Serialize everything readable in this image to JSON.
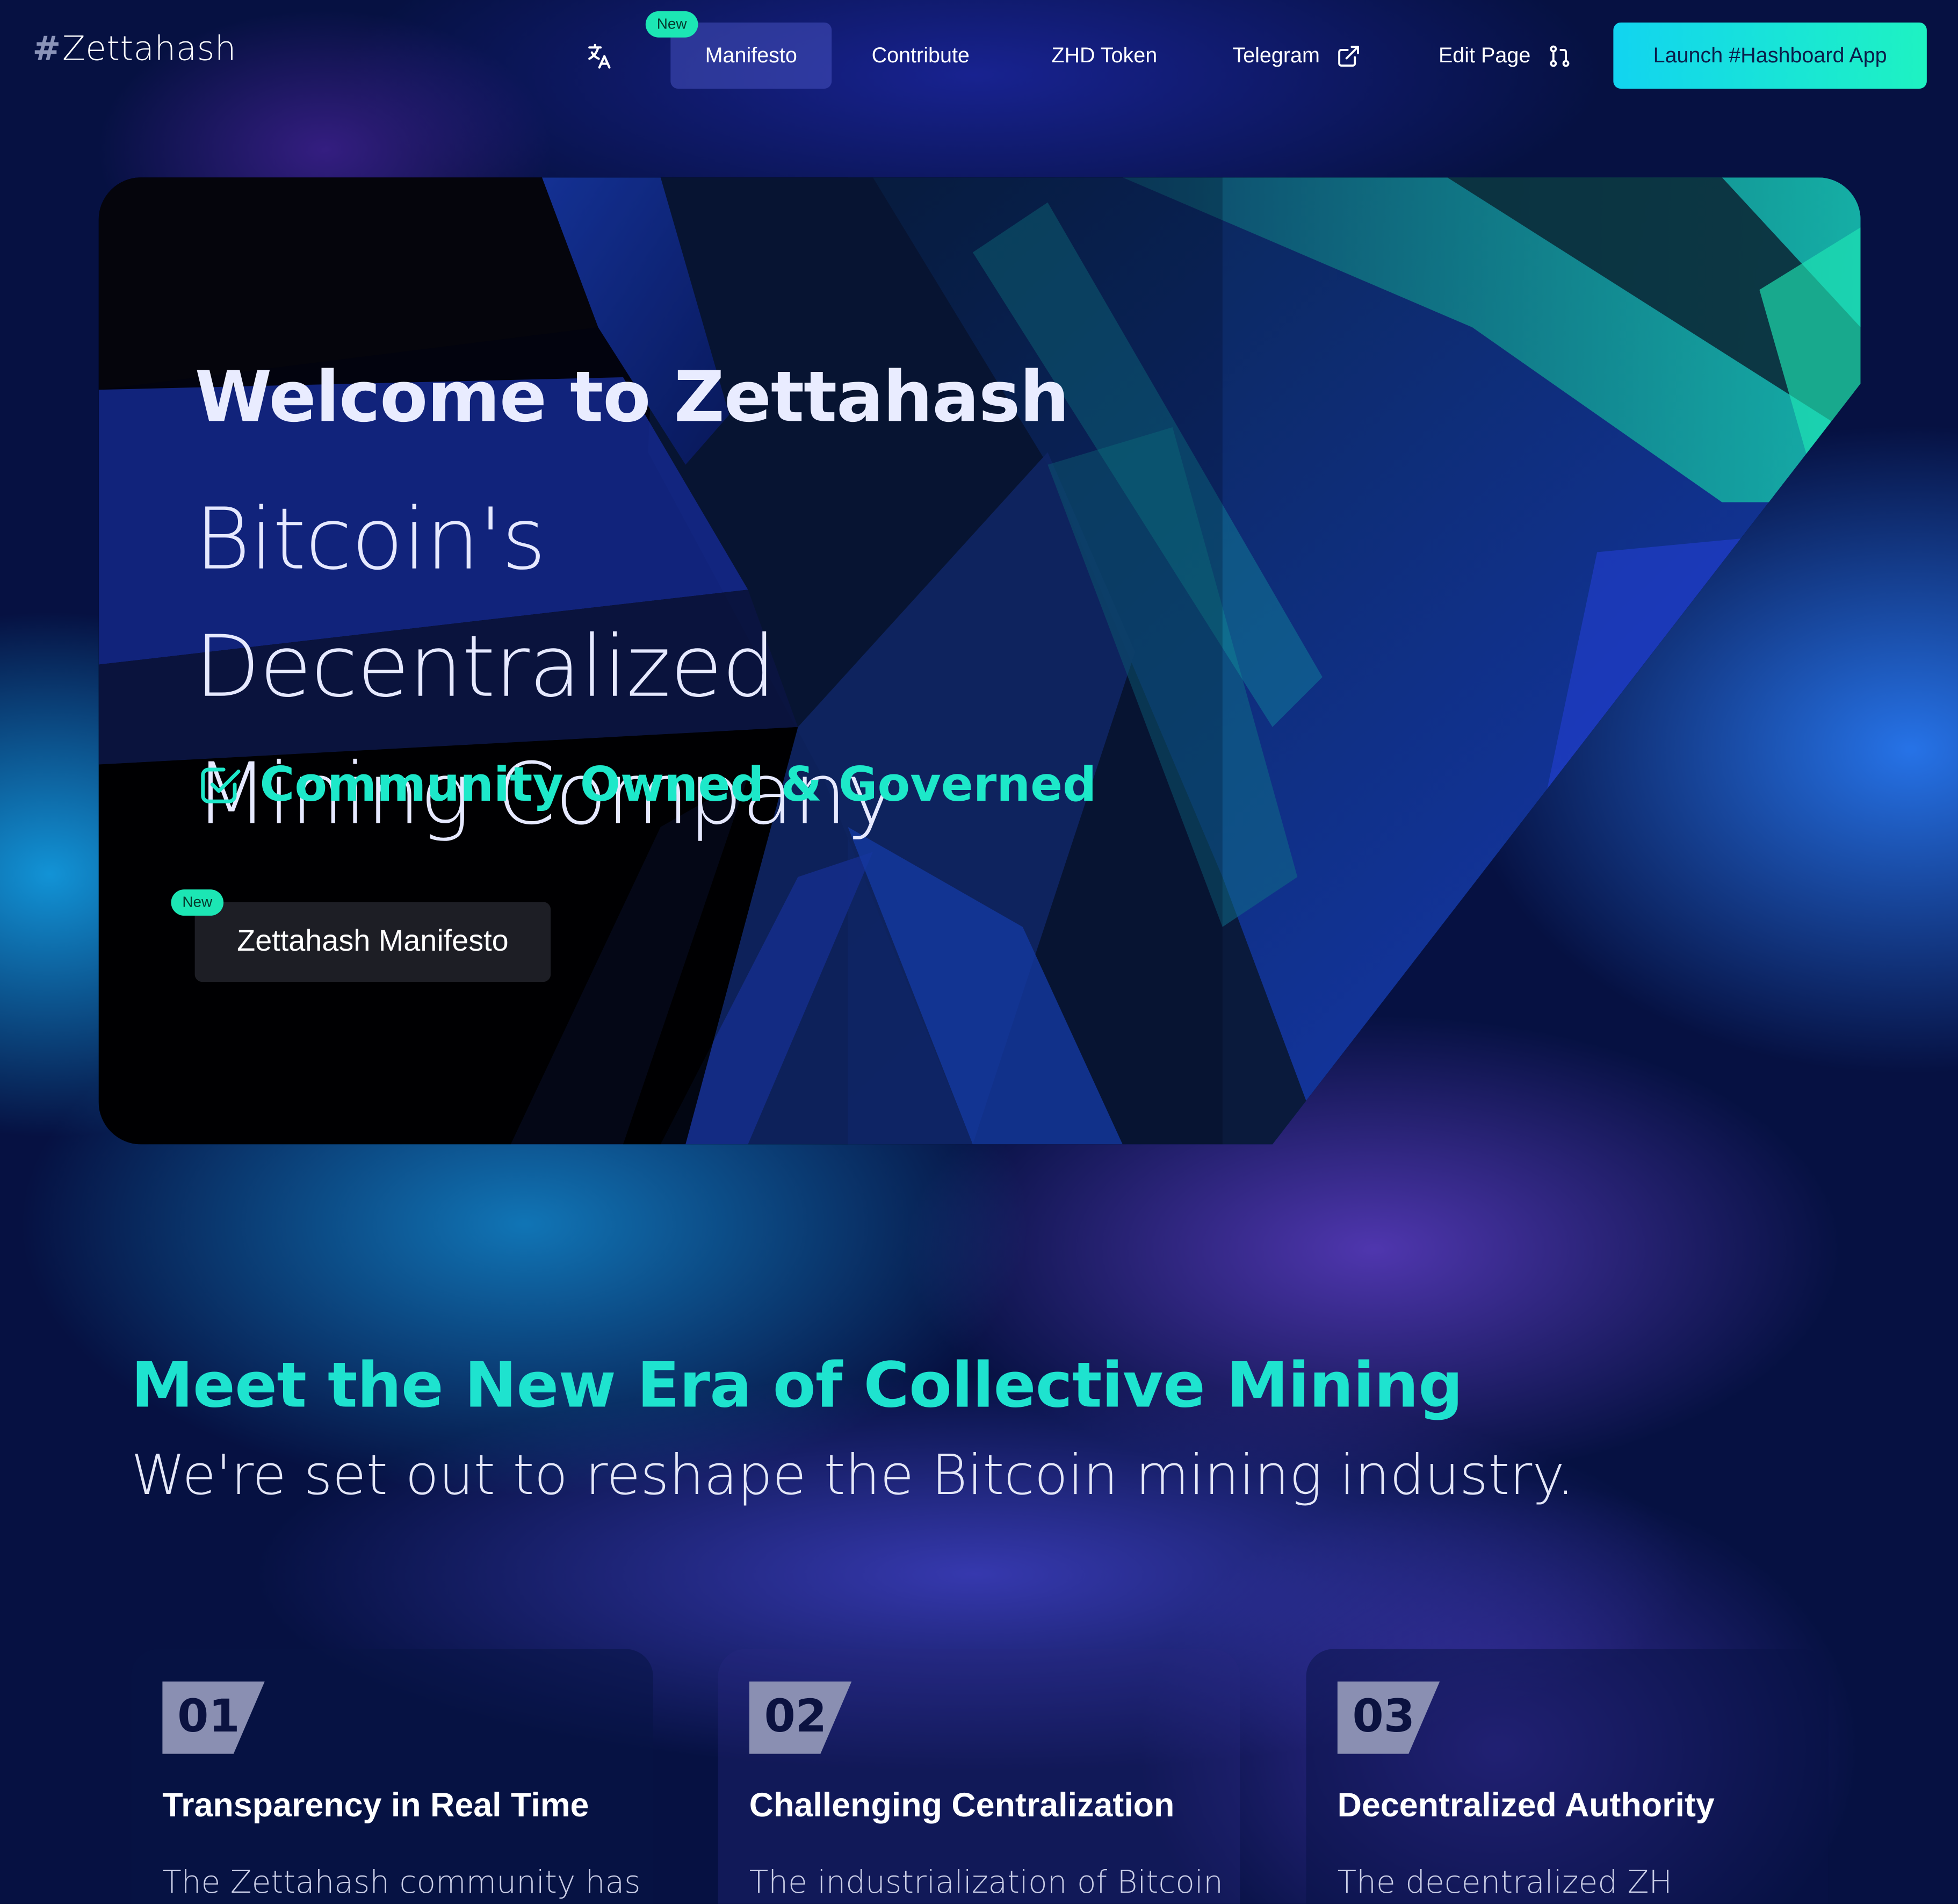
{
  "nav": {
    "logo_text": "Zettahash",
    "items": [
      {
        "label": "Manifesto",
        "badge": "New"
      },
      {
        "label": "Contribute"
      },
      {
        "label": "ZHD Token"
      },
      {
        "label": "Telegram"
      },
      {
        "label": "Edit Page"
      }
    ],
    "launch_label": "Launch #Hashboard App"
  },
  "hero": {
    "title": "Welcome to Zettahash",
    "subtitle_line1": "Bitcoin's Decentralized",
    "subtitle_line2": "Mining Company",
    "tagline": "Community Owned & Governed",
    "button_label": "Zettahash Manifesto",
    "button_badge": "New"
  },
  "section": {
    "title": "Meet the New Era of Collective Mining",
    "subtitle": "We're set out to reshape the Bitcoin mining industry."
  },
  "features": [
    {
      "number": "01",
      "title": "Transparency in Real Time",
      "text": "The Zettahash community has"
    },
    {
      "number": "02",
      "title": "Challenging Centralization",
      "text": "The industrialization of Bitcoin"
    },
    {
      "number": "03",
      "title": "Decentralized Authority",
      "text": "The decentralized ZH"
    }
  ],
  "colors": {
    "accent": "#1de8c9",
    "badge": "#1ce6b4",
    "launch_gradient_start": "#12d4f0",
    "launch_gradient_end": "#1ef2c2"
  }
}
